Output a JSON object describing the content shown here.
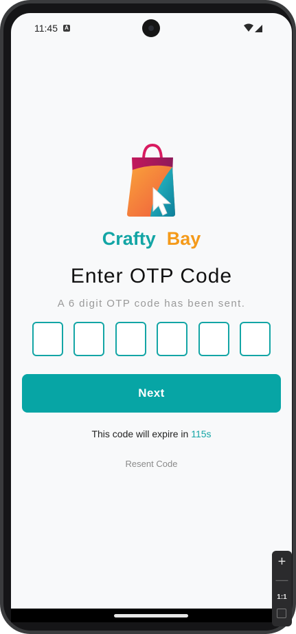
{
  "status_bar": {
    "time": "11:45",
    "notification_badge": "A",
    "wifi_icon": "wifi-icon",
    "signal_icon": "cell-signal-icon"
  },
  "brand": {
    "word1": "Crafty",
    "word2": "Bay",
    "color_primary": "#13a5a5",
    "color_secondary": "#f49a1a"
  },
  "otp": {
    "title": "Enter OTP Code",
    "subtitle": "A 6 digit OTP code has been sent.",
    "digits": [
      "",
      "",
      "",
      "",
      "",
      ""
    ]
  },
  "actions": {
    "next_label": "Next",
    "expire_prefix": "This code will expire in ",
    "expire_seconds": "115s",
    "resend_label": "Resent Code"
  },
  "emulator_controls": {
    "zoom_in": "+",
    "zoom_out": "—",
    "ratio": "1:1"
  }
}
